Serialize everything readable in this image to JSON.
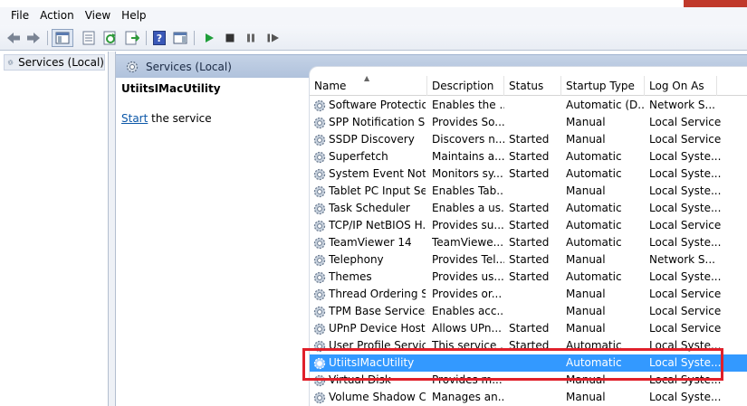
{
  "menu": [
    "File",
    "Action",
    "View",
    "Help"
  ],
  "toolbar": {
    "icons": [
      "back-arrow-icon",
      "forward-arrow-icon",
      "show-hide-console-tree-icon",
      "properties-icon",
      "refresh-icon",
      "export-list-icon",
      "help-icon",
      "show-hide-action-pane-icon",
      "play-icon",
      "stop-icon",
      "pause-icon",
      "restart-icon"
    ]
  },
  "tree": {
    "item_label": "Services (Local)"
  },
  "panel": {
    "header_label": "Services (Local)",
    "selected_service_title": "UtiitsIMacUtility",
    "action_link": "Start",
    "action_suffix": " the service"
  },
  "columns": [
    "Name",
    "Description",
    "Status",
    "Startup Type",
    "Log On As"
  ],
  "rows": [
    {
      "name": "Software Protection",
      "description": "Enables the ...",
      "status": "",
      "startup": "Automatic (D...",
      "logon": "Network S..."
    },
    {
      "name": "SPP Notification S...",
      "description": "Provides So...",
      "status": "",
      "startup": "Manual",
      "logon": "Local Service"
    },
    {
      "name": "SSDP Discovery",
      "description": "Discovers n...",
      "status": "Started",
      "startup": "Manual",
      "logon": "Local Service"
    },
    {
      "name": "Superfetch",
      "description": "Maintains a...",
      "status": "Started",
      "startup": "Automatic",
      "logon": "Local Syste..."
    },
    {
      "name": "System Event Noti...",
      "description": "Monitors sy...",
      "status": "Started",
      "startup": "Automatic",
      "logon": "Local Syste..."
    },
    {
      "name": "Tablet PC Input Se...",
      "description": "Enables Tab...",
      "status": "",
      "startup": "Manual",
      "logon": "Local Syste..."
    },
    {
      "name": "Task Scheduler",
      "description": "Enables a us...",
      "status": "Started",
      "startup": "Automatic",
      "logon": "Local Syste..."
    },
    {
      "name": "TCP/IP NetBIOS H...",
      "description": "Provides su...",
      "status": "Started",
      "startup": "Automatic",
      "logon": "Local Service"
    },
    {
      "name": "TeamViewer 14",
      "description": "TeamViewe...",
      "status": "Started",
      "startup": "Automatic",
      "logon": "Local Syste..."
    },
    {
      "name": "Telephony",
      "description": "Provides Tel...",
      "status": "Started",
      "startup": "Manual",
      "logon": "Network S..."
    },
    {
      "name": "Themes",
      "description": "Provides us...",
      "status": "Started",
      "startup": "Automatic",
      "logon": "Local Syste..."
    },
    {
      "name": "Thread Ordering S...",
      "description": "Provides or...",
      "status": "",
      "startup": "Manual",
      "logon": "Local Service"
    },
    {
      "name": "TPM Base Services",
      "description": "Enables acc...",
      "status": "",
      "startup": "Manual",
      "logon": "Local Service"
    },
    {
      "name": "UPnP Device Host",
      "description": "Allows UPn...",
      "status": "Started",
      "startup": "Manual",
      "logon": "Local Service"
    },
    {
      "name": "User Profile Service",
      "description": "This service ...",
      "status": "Started",
      "startup": "Automatic",
      "logon": "Local Syste..."
    },
    {
      "name": "UtiitsIMacUtility",
      "description": "",
      "status": "",
      "startup": "Automatic",
      "logon": "Local Syste...",
      "selected": true
    },
    {
      "name": "Virtual Disk",
      "description": "Provides m...",
      "status": "",
      "startup": "Manual",
      "logon": "Local Syste..."
    },
    {
      "name": "Volume Shadow C...",
      "description": "Manages an...",
      "status": "",
      "startup": "Manual",
      "logon": "Local Syste..."
    }
  ],
  "colors": {
    "selection": "#3399ff",
    "highlight_box": "#e0202a"
  }
}
